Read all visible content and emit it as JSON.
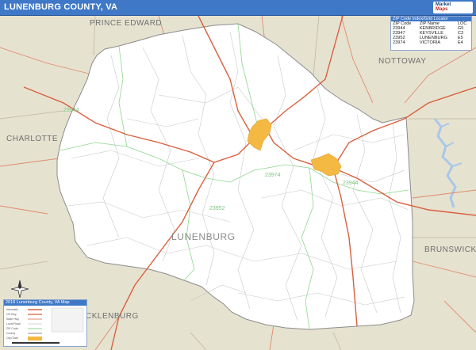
{
  "title": "LUNENBURG COUNTY, VA",
  "logo": {
    "line1": "Market",
    "line2": "Maps"
  },
  "regions": {
    "prince_edward": "PRINCE EDWARD",
    "nottoway": "NOTTOWAY",
    "charlotte": "CHARLOTTE",
    "brunswick": "BRUNSWICK",
    "mecklenburg": "CKLENBURG"
  },
  "county_label": "LUNENBURG",
  "zip_labels": {
    "z1": "23944",
    "z2": "23974",
    "z3": "23952",
    "z4": "23944"
  },
  "zip_locator": {
    "header": "ZIP Code Index/Grid Locator",
    "columns": [
      "ZIP Code",
      "ZIP Name",
      "LOC"
    ],
    "rows": [
      [
        "23944",
        "KENBRIDGE",
        "G5"
      ],
      [
        "23947",
        "KEYSVILLE",
        "C3"
      ],
      [
        "23952",
        "LUNENBURG",
        "E5"
      ],
      [
        "23974",
        "VICTORIA",
        "E4"
      ]
    ]
  },
  "legend": {
    "header": "2018 Lunenburg County, VA Map",
    "items": [
      "Interstate",
      "US Hwy",
      "State Hwy",
      "Local Road",
      "ZIP Code",
      "County",
      "City/Town"
    ]
  },
  "colors": {
    "header_blue": "#3f78c7",
    "outside_county": "#e6e2d0",
    "county_fill": "#ffffff",
    "highway_red": "#d9603f",
    "zip_boundary_green": "#8fd68f",
    "town_orange": "#f4b942",
    "water_blue": "#a9c8e8"
  },
  "compass_icon": "compass-rose-icon"
}
